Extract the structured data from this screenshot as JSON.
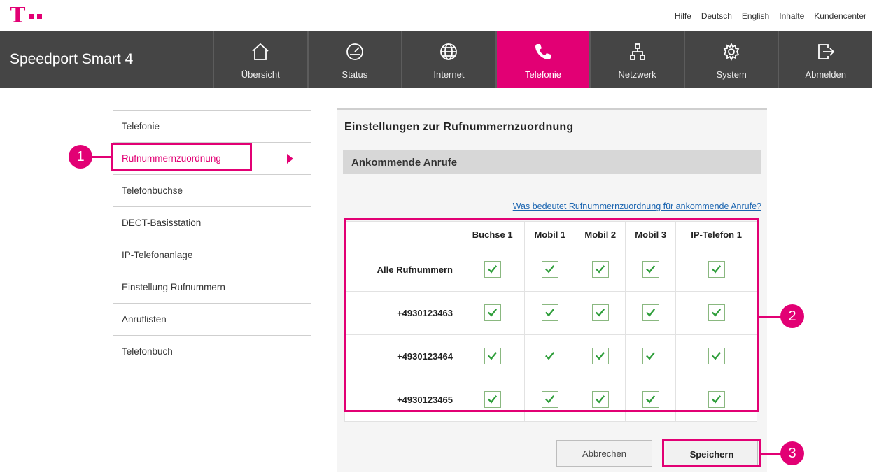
{
  "brand_color": "#e20074",
  "logo": {
    "mark": "T",
    "icon": "telekom-logo"
  },
  "toplinks": [
    "Hilfe",
    "Deutsch",
    "English",
    "Inhalte",
    "Kundencenter"
  ],
  "product": "Speedport Smart 4",
  "nav": [
    {
      "label": "Übersicht",
      "icon": "home-icon"
    },
    {
      "label": "Status",
      "icon": "gauge-icon"
    },
    {
      "label": "Internet",
      "icon": "globe-icon"
    },
    {
      "label": "Telefonie",
      "icon": "phone-icon",
      "active": true
    },
    {
      "label": "Netzwerk",
      "icon": "network-icon"
    },
    {
      "label": "System",
      "icon": "gear-icon"
    },
    {
      "label": "Abmelden",
      "icon": "logout-icon"
    }
  ],
  "sidebar": [
    {
      "label": "Telefonie"
    },
    {
      "label": "Rufnummernzuordnung",
      "active": true
    },
    {
      "label": "Telefonbuchse"
    },
    {
      "label": "DECT-Basisstation"
    },
    {
      "label": "IP-Telefonanlage"
    },
    {
      "label": "Einstellung Rufnummern"
    },
    {
      "label": "Anruflisten"
    },
    {
      "label": "Telefonbuch"
    }
  ],
  "main": {
    "title": "Einstellungen zur Rufnummernzuordnung",
    "section": "Ankommende Anrufe",
    "help_link": "Was bedeutet Rufnummernzuordnung für ankommende Anrufe?",
    "columns": [
      "Buchse 1",
      "Mobil 1",
      "Mobil 2",
      "Mobil 3",
      "IP-Telefon 1"
    ],
    "rows": [
      {
        "label": "Alle Rufnummern",
        "checked": [
          true,
          true,
          true,
          true,
          true
        ]
      },
      {
        "label": "+4930123463",
        "checked": [
          true,
          true,
          true,
          true,
          true
        ]
      },
      {
        "label": "+4930123464",
        "checked": [
          true,
          true,
          true,
          true,
          true
        ]
      },
      {
        "label": "+4930123465",
        "checked": [
          true,
          true,
          true,
          true,
          true
        ]
      }
    ],
    "cancel_label": "Abbrechen",
    "save_label": "Speichern"
  },
  "callouts": [
    "1",
    "2",
    "3"
  ]
}
